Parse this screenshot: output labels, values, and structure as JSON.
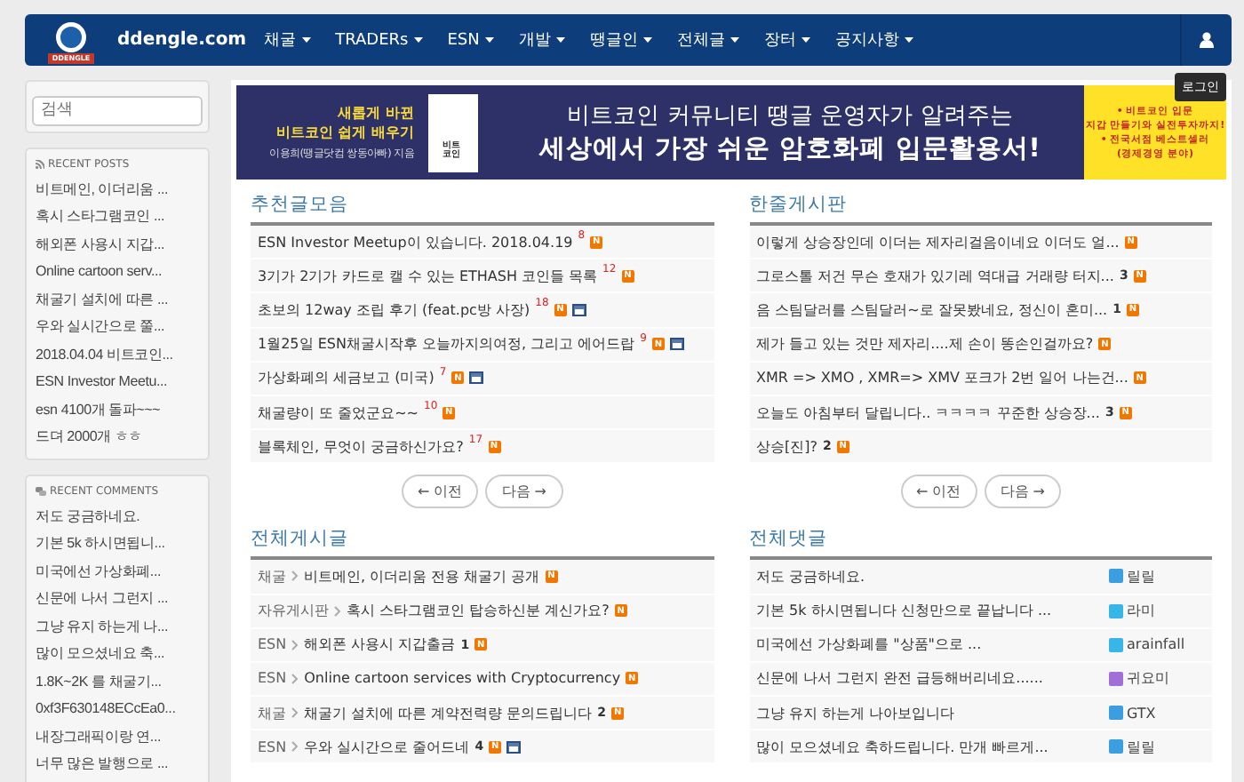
{
  "navbar": {
    "brand": "ddengle.com",
    "logo_text": "DDENGLE",
    "menu": [
      {
        "label": "채굴"
      },
      {
        "label": "TRADERs"
      },
      {
        "label": "ESN"
      },
      {
        "label": "개발"
      },
      {
        "label": "땡글인"
      },
      {
        "label": "전체글"
      },
      {
        "label": "장터"
      },
      {
        "label": "공지사항"
      }
    ],
    "login_tooltip": "로그인"
  },
  "sidebar": {
    "search": {
      "placeholder": "검색"
    },
    "recent_posts": {
      "title": "RECENT POSTS",
      "items": [
        "비트메인, 이더리움 ...",
        "혹시 스타그램코인 ...",
        "해외폰 사용시 지갑...",
        "Online cartoon serv...",
        "채굴기 설치에 따른 ...",
        "우와 실시간으로 쭐...",
        "2018.04.04 비트코인...",
        "ESN Investor Meetu...",
        "esn 4100개 돌파~~~",
        "드뎌 2000개 ㅎㅎ"
      ]
    },
    "recent_comments": {
      "title": "RECENT COMMENTS",
      "items": [
        "저도 궁금하네요.",
        "기본 5k 하시면됩니...",
        "미국에선 가상화폐...",
        "신문에 나서 그런지 ...",
        "그냥 유지 하는게 나...",
        "많이 모으셨네요 축...",
        "1.8K~2K 를 채굴기...",
        "0xf3F630148ECcEa0...",
        "내장그래픽이랑 연...",
        "너무 많은 발행으로 ..."
      ]
    }
  },
  "banner": {
    "left_line_1": "새롭게 바뀐",
    "left_line_2": "비트코인 쉽게 배우기",
    "left_author": "이용희(땡글닷컴 쌍동아빠) 지음",
    "book_title": "비트코인",
    "headline_1": "비트코인 커뮤니티 땡글 운영자가 알려주는",
    "headline_2": "세상에서 가장 쉬운 암호화폐 입문활용서!",
    "right_lines": [
      "• 비트코인 입문",
      "지갑 만들기와 실전투자까지!",
      "• 전국서점 베스트셀러",
      "(경제경영 분야)"
    ]
  },
  "panels": [
    {
      "title": "추천글모음",
      "kind": "posts",
      "items": [
        {
          "text": "ESN Investor Meetup이 있습니다. 2018.04.19",
          "count": "8",
          "badge": "N",
          "has_image": false
        },
        {
          "text": "3기가 2기가 카드로 캘 수 있는 ETHASH 코인들 목록",
          "count": "12",
          "badge": "N",
          "has_image": false
        },
        {
          "text": "초보의 12way 조립 후기 (feat.pc방 사장)",
          "count": "18",
          "badge": "N",
          "has_image": true
        },
        {
          "text": "1월25일 ESN채굴시작후 오늘까지의여정, 그리고 에어드랍",
          "count": "9",
          "badge": "N",
          "has_image": true
        },
        {
          "text": "가상화폐의 세금보고 (미국)",
          "count": "7",
          "badge": "N",
          "has_image": true
        },
        {
          "text": "채굴량이 또 줄었군요~~",
          "count": "10",
          "badge": "N",
          "has_image": false
        },
        {
          "text": "블록체인, 무엇이 궁금하신가요?",
          "count": "17",
          "badge": "N",
          "has_image": false
        }
      ],
      "pager": {
        "prev": "← 이전",
        "next": "다음 →"
      }
    },
    {
      "title": "한줄게시판",
      "kind": "oneline",
      "items": [
        {
          "text": "이렇게 상승장인데 이더는 제자리걸음이네요 이더도 얼...",
          "badge": "N"
        },
        {
          "text": "그로스톨 저건 무슨 호재가 있기레 역대급 거래량 터지...",
          "count": "3",
          "badge": "N"
        },
        {
          "text": "음 스팀달러를 스팀달러~로 잘못봤네요, 정신이 혼미...",
          "count": "1",
          "badge": "N"
        },
        {
          "text": "제가 들고 있는 것만 제자리....제 손이 똥손인걸까요?",
          "badge": "N"
        },
        {
          "text": "XMR => XMO , XMR=> XMV 포크가 2번 일어 나는건...",
          "badge": "N"
        },
        {
          "text": "오늘도 아침부터 달립니다.. ㅋㅋㅋㅋ 꾸준한 상승장...",
          "count": "3",
          "badge": "N"
        },
        {
          "text": "상승[진]?",
          "count": "2",
          "badge": "N"
        }
      ],
      "pager": {
        "prev": "← 이전",
        "next": "다음 →"
      }
    },
    {
      "title": "전체게시글",
      "kind": "categorized",
      "items": [
        {
          "category": "채굴",
          "text": "비트메인, 이더리움 전용 채굴기 공개",
          "badge": "N",
          "has_image": false
        },
        {
          "category": "자유게시판",
          "text": "혹시 스타그램코인 탑승하신분 계신가요?",
          "badge": "N",
          "has_image": false
        },
        {
          "category": "ESN",
          "text": "해외폰 사용시 지갑출금",
          "count": "1",
          "badge": "N",
          "has_image": false
        },
        {
          "category": "ESN",
          "text": "Online cartoon services with Cryptocurrency",
          "badge": "N",
          "has_image": false
        },
        {
          "category": "채굴",
          "text": "채굴기 설치에 따른 계약전력량 문의드립니다",
          "count": "2",
          "badge": "N",
          "has_image": false
        },
        {
          "category": "ESN",
          "text": "우와 실시간으로 줄어드네",
          "count": "4",
          "badge": "N",
          "has_image": true
        }
      ]
    },
    {
      "title": "전체댓글",
      "kind": "comments",
      "items": [
        {
          "text": "저도 궁금하네요.",
          "author": "릴릴",
          "color": "#3b9ee0"
        },
        {
          "text": "기본 5k 하시면됩니다 신청만으로 끝납니다 ...",
          "author": "라미",
          "color": "#38b6e8"
        },
        {
          "text": "미국에선 가상화폐를 \"상품\"으로 ...",
          "author": "arainfall",
          "color": "#38b6e8"
        },
        {
          "text": "신문에 나서 그런지 완전 급등해버리네요......",
          "author": "귀요미",
          "color": "#a070d8"
        },
        {
          "text": "그냥 유지 하는게 나아보입니다",
          "author": "GTX",
          "color": "#3b9ee0"
        },
        {
          "text": "많이 모으셨네요 축하드립니다. 만개 빠르게...",
          "author": "릴릴",
          "color": "#3b9ee0"
        }
      ]
    }
  ]
}
